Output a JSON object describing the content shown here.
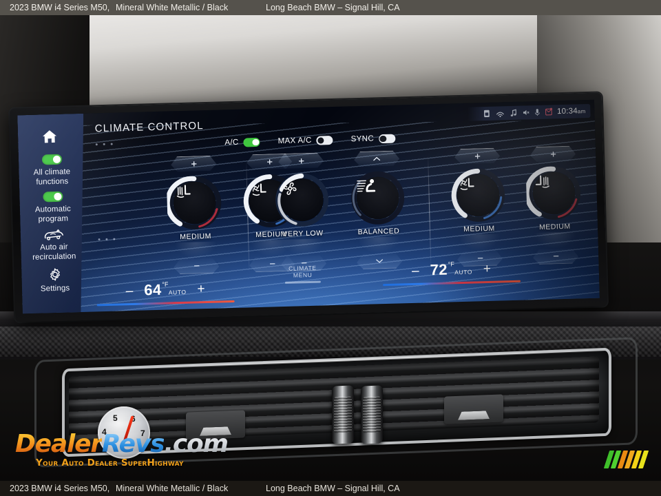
{
  "caption": {
    "vehicle": "2023 BMW i4 Series M50,",
    "color": "Mineral White Metallic / Black",
    "dealer": "Long Beach BMW – Signal Hill, CA"
  },
  "screen": {
    "header_title": "CLIMATE CONTROL",
    "statusbar": {
      "clock_time": "10:34",
      "clock_ampm": "am",
      "icons": [
        "sim-card-icon",
        "wifi-hotspot-icon",
        "music-note-icon",
        "mute-speaker-icon",
        "microphone-icon",
        "message-alert-icon"
      ]
    },
    "sidebar": {
      "home_icon": "home-icon",
      "items": [
        {
          "label_line1": "All climate",
          "label_line2": "functions",
          "control": "toggle",
          "state": "on",
          "icon": "toggle-switch-icon"
        },
        {
          "label_line1": "Automatic",
          "label_line2": "program",
          "control": "toggle",
          "state": "on",
          "icon": "toggle-switch-icon"
        },
        {
          "label_line1": "Auto air",
          "label_line2": "recirculation",
          "control": "icon",
          "state": "off",
          "icon": "air-recirculation-icon"
        },
        {
          "label_line1": "Settings",
          "label_line2": "",
          "control": "icon",
          "state": "off",
          "icon": "gear-icon"
        }
      ]
    },
    "toprow": [
      {
        "label": "A/C",
        "state": "on",
        "name": "ac-toggle"
      },
      {
        "label": "MAX A/C",
        "state": "off",
        "name": "max-ac-toggle"
      },
      {
        "label": "SYNC",
        "state": "off",
        "name": "sync-toggle"
      }
    ],
    "dials": [
      {
        "name": "driver-seat-heating",
        "icon": "heated-seat-icon",
        "value_label": "MEDIUM",
        "up_glyph": "+",
        "down_glyph": "–",
        "arc_color": "#f0f3f8",
        "arc_accent": "#c8303f",
        "arc_percent": 62
      },
      {
        "name": "driver-seat-ventilation",
        "icon": "ventilated-seat-icon",
        "value_label": "MEDIUM",
        "up_glyph": "+",
        "down_glyph": "–",
        "arc_color": "#f0f3f8",
        "arc_accent": "#3f7fd8",
        "arc_percent": 58
      },
      {
        "name": "fan-speed",
        "icon": "fan-icon",
        "value_label": "VERY LOW",
        "up_glyph": "+",
        "down_glyph": "–",
        "arc_color": "#f0f3f8",
        "arc_accent": "#24406e",
        "arc_percent": 24
      },
      {
        "name": "airflow-distribution",
        "icon": "seated-person-airflow-icon",
        "value_label": "BALANCED",
        "up_glyph": "chevron-up",
        "down_glyph": "chevron-down",
        "arc_color": "#f0f3f8",
        "arc_accent": "#24406e",
        "arc_percent": 0
      },
      {
        "name": "passenger-seat-ventilation",
        "icon": "ventilated-seat-icon",
        "value_label": "MEDIUM",
        "up_glyph": "+",
        "down_glyph": "–",
        "arc_color": "#f0f3f8",
        "arc_accent": "#3f7fd8",
        "arc_percent": 58
      },
      {
        "name": "passenger-seat-heating",
        "icon": "heated-seat-icon",
        "value_label": "MEDIUM",
        "up_glyph": "+",
        "down_glyph": "–",
        "arc_color": "#f0f3f8",
        "arc_accent": "#c8303f",
        "arc_percent": 62
      }
    ],
    "temperature": {
      "driver": {
        "value": "64",
        "unit": "°F",
        "mode": "AUTO",
        "minus": "–",
        "plus": "+"
      },
      "passenger": {
        "value": "72",
        "unit": "°F",
        "mode": "AUTO",
        "minus": "–",
        "plus": "+"
      }
    },
    "climate_menu": {
      "line1": "CLIMATE",
      "line2": "MENU"
    }
  },
  "watermark": {
    "part1": "Dealer",
    "part2": "Revs",
    "part3": ".com",
    "tagline": "Your Auto Dealer SuperHighway",
    "gauge_ticks": [
      "4",
      "5",
      "6",
      "7"
    ]
  },
  "accent_bars": [
    "#3fbf2a",
    "#4fd02f",
    "#e98a12",
    "#f0a81d",
    "#f2d216",
    "#e8e21c"
  ]
}
